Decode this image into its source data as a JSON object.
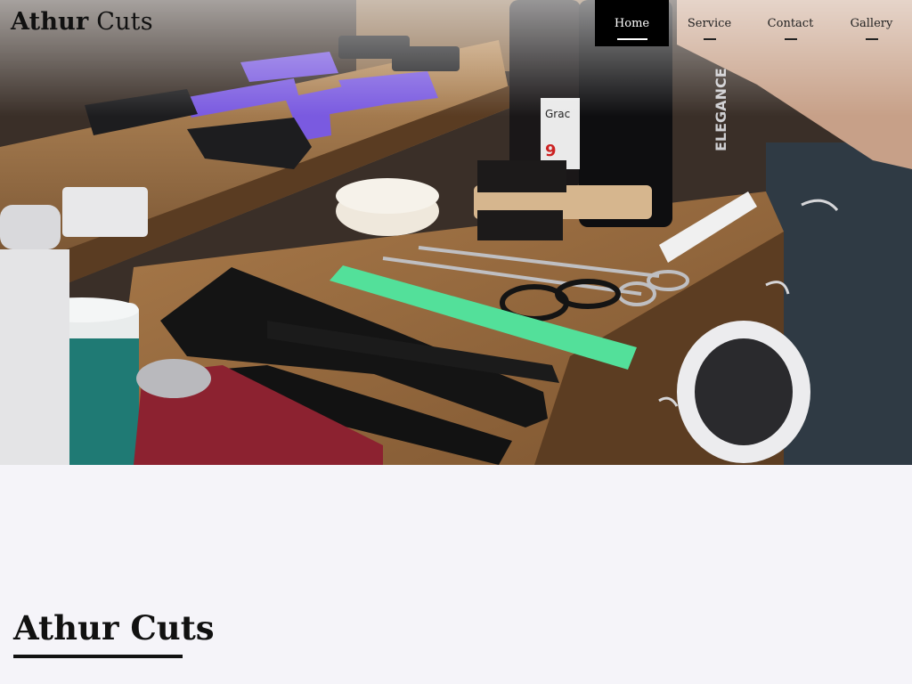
{
  "brand": {
    "bold": "Athur",
    "light": "Cuts"
  },
  "nav": {
    "items": [
      {
        "label": "Home",
        "active": true
      },
      {
        "label": "Service",
        "active": false
      },
      {
        "label": "Contact",
        "active": false
      },
      {
        "label": "Gallery",
        "active": false
      }
    ]
  },
  "hero": {
    "image": "barber-tools-photo"
  },
  "section": {
    "title_bold": "Athur",
    "title_light": "Cuts"
  },
  "colors": {
    "accent": "#000000",
    "background": "#f5f4f9",
    "text": "#111111"
  }
}
